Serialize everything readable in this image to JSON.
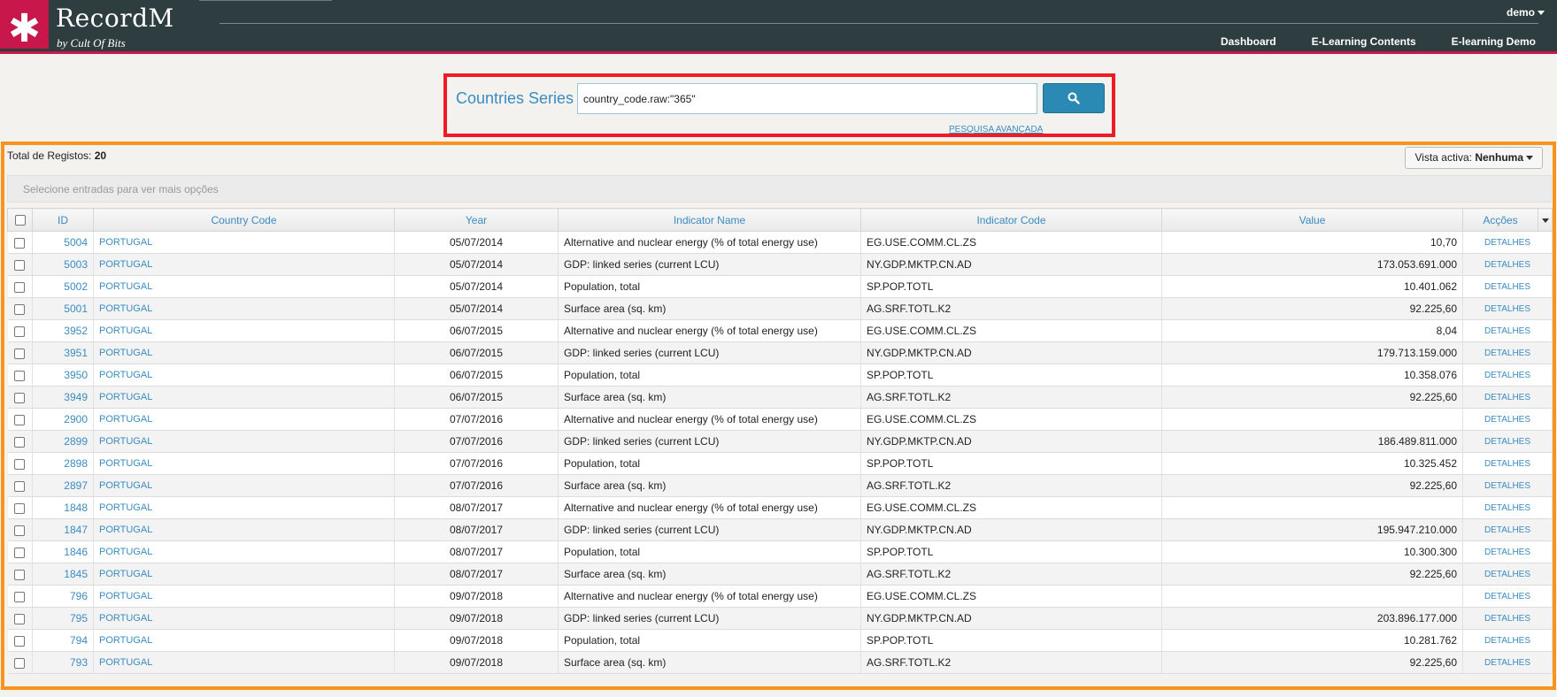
{
  "app": {
    "title": "RecordM",
    "subtitle": "by Cult Of Bits",
    "logo_glyph": "✱"
  },
  "user": {
    "name": "demo"
  },
  "nav": [
    "Dashboard",
    "E-Learning Contents",
    "E-learning Demo"
  ],
  "search": {
    "title": "Countries Series",
    "value": "country_code.raw:\"365\"",
    "advanced": "PESQUISA AVANÇADA"
  },
  "results": {
    "total_label": "Total de Registos:",
    "total_value": "20",
    "vista_label": "Vista activa:",
    "vista_value": "Nenhuma",
    "selection_hint": "Selecione entradas para ver mais opções"
  },
  "table": {
    "columns": [
      "ID",
      "Country Code",
      "Year",
      "Indicator Name",
      "Indicator Code",
      "Value",
      "Acções"
    ],
    "rows": [
      {
        "id": "5004",
        "cc": "PORTUGAL",
        "year": "05/07/2014",
        "name": "Alternative and nuclear energy (% of total energy use)",
        "code": "EG.USE.COMM.CL.ZS",
        "value": "10,70",
        "action": "DETALHES"
      },
      {
        "id": "5003",
        "cc": "PORTUGAL",
        "year": "05/07/2014",
        "name": "GDP: linked series (current LCU)",
        "code": "NY.GDP.MKTP.CN.AD",
        "value": "173.053.691.000",
        "action": "DETALHES"
      },
      {
        "id": "5002",
        "cc": "PORTUGAL",
        "year": "05/07/2014",
        "name": "Population, total",
        "code": "SP.POP.TOTL",
        "value": "10.401.062",
        "action": "DETALHES"
      },
      {
        "id": "5001",
        "cc": "PORTUGAL",
        "year": "05/07/2014",
        "name": "Surface area (sq. km)",
        "code": "AG.SRF.TOTL.K2",
        "value": "92.225,60",
        "action": "DETALHES"
      },
      {
        "id": "3952",
        "cc": "PORTUGAL",
        "year": "06/07/2015",
        "name": "Alternative and nuclear energy (% of total energy use)",
        "code": "EG.USE.COMM.CL.ZS",
        "value": "8,04",
        "action": "DETALHES"
      },
      {
        "id": "3951",
        "cc": "PORTUGAL",
        "year": "06/07/2015",
        "name": "GDP: linked series (current LCU)",
        "code": "NY.GDP.MKTP.CN.AD",
        "value": "179.713.159.000",
        "action": "DETALHES"
      },
      {
        "id": "3950",
        "cc": "PORTUGAL",
        "year": "06/07/2015",
        "name": "Population, total",
        "code": "SP.POP.TOTL",
        "value": "10.358.076",
        "action": "DETALHES"
      },
      {
        "id": "3949",
        "cc": "PORTUGAL",
        "year": "06/07/2015",
        "name": "Surface area (sq. km)",
        "code": "AG.SRF.TOTL.K2",
        "value": "92.225,60",
        "action": "DETALHES"
      },
      {
        "id": "2900",
        "cc": "PORTUGAL",
        "year": "07/07/2016",
        "name": "Alternative and nuclear energy (% of total energy use)",
        "code": "EG.USE.COMM.CL.ZS",
        "value": "",
        "action": "DETALHES"
      },
      {
        "id": "2899",
        "cc": "PORTUGAL",
        "year": "07/07/2016",
        "name": "GDP: linked series (current LCU)",
        "code": "NY.GDP.MKTP.CN.AD",
        "value": "186.489.811.000",
        "action": "DETALHES"
      },
      {
        "id": "2898",
        "cc": "PORTUGAL",
        "year": "07/07/2016",
        "name": "Population, total",
        "code": "SP.POP.TOTL",
        "value": "10.325.452",
        "action": "DETALHES"
      },
      {
        "id": "2897",
        "cc": "PORTUGAL",
        "year": "07/07/2016",
        "name": "Surface area (sq. km)",
        "code": "AG.SRF.TOTL.K2",
        "value": "92.225,60",
        "action": "DETALHES"
      },
      {
        "id": "1848",
        "cc": "PORTUGAL",
        "year": "08/07/2017",
        "name": "Alternative and nuclear energy (% of total energy use)",
        "code": "EG.USE.COMM.CL.ZS",
        "value": "",
        "action": "DETALHES"
      },
      {
        "id": "1847",
        "cc": "PORTUGAL",
        "year": "08/07/2017",
        "name": "GDP: linked series (current LCU)",
        "code": "NY.GDP.MKTP.CN.AD",
        "value": "195.947.210.000",
        "action": "DETALHES"
      },
      {
        "id": "1846",
        "cc": "PORTUGAL",
        "year": "08/07/2017",
        "name": "Population, total",
        "code": "SP.POP.TOTL",
        "value": "10.300.300",
        "action": "DETALHES"
      },
      {
        "id": "1845",
        "cc": "PORTUGAL",
        "year": "08/07/2017",
        "name": "Surface area (sq. km)",
        "code": "AG.SRF.TOTL.K2",
        "value": "92.225,60",
        "action": "DETALHES"
      },
      {
        "id": "796",
        "cc": "PORTUGAL",
        "year": "09/07/2018",
        "name": "Alternative and nuclear energy (% of total energy use)",
        "code": "EG.USE.COMM.CL.ZS",
        "value": "",
        "action": "DETALHES"
      },
      {
        "id": "795",
        "cc": "PORTUGAL",
        "year": "09/07/2018",
        "name": "GDP: linked series (current LCU)",
        "code": "NY.GDP.MKTP.CN.AD",
        "value": "203.896.177.000",
        "action": "DETALHES"
      },
      {
        "id": "794",
        "cc": "PORTUGAL",
        "year": "09/07/2018",
        "name": "Population, total",
        "code": "SP.POP.TOTL",
        "value": "10.281.762",
        "action": "DETALHES"
      },
      {
        "id": "793",
        "cc": "PORTUGAL",
        "year": "09/07/2018",
        "name": "Surface area (sq. km)",
        "code": "AG.SRF.TOTL.K2",
        "value": "92.225,60",
        "action": "DETALHES"
      }
    ]
  },
  "colors": {
    "header_bg": "#2e3d40",
    "brand": "#c8174a",
    "link": "#3a8cc1",
    "search_highlight": "#ee1c25",
    "results_highlight": "#f7941d"
  },
  "icons": {
    "search": "search-icon",
    "logo": "asterisk-icon",
    "caret": "caret-down-icon"
  }
}
